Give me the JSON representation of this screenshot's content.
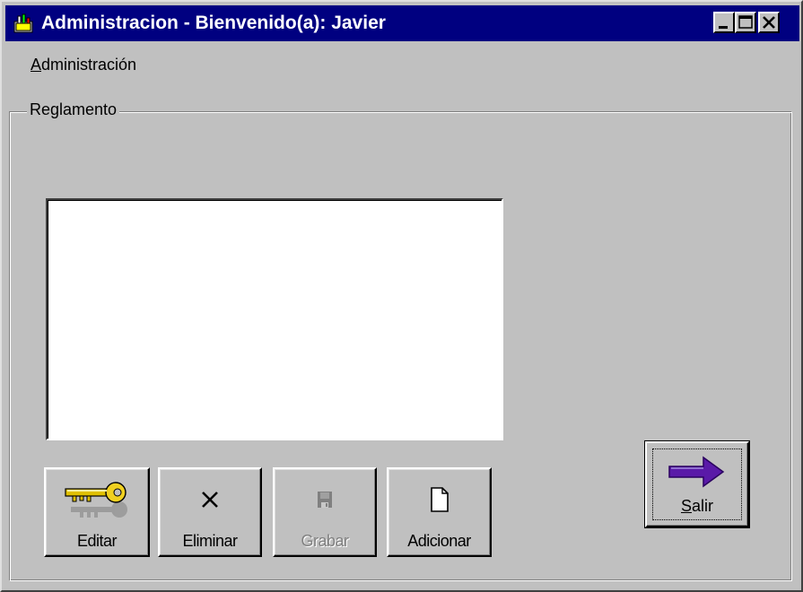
{
  "window": {
    "title": "Administracion - Bienvenido(a): Javier",
    "controls": {
      "minimize": "minimize-icon",
      "maximize": "maximize-icon",
      "close": "close-icon"
    }
  },
  "menu": {
    "items": [
      {
        "label_first": "A",
        "label_rest": "dministración"
      }
    ]
  },
  "group": {
    "label": "Reglamento"
  },
  "list": {
    "items": []
  },
  "toolbar": {
    "editar_label": "Editar",
    "eliminar_label": "Eliminar",
    "grabar_label": "Grabar",
    "adicionar_label": "Adicionar"
  },
  "exit": {
    "label_first": "S",
    "label_rest": "alir"
  },
  "colors": {
    "titlebar": "#000080",
    "face": "#c0c0c0",
    "arrow": "#5000a0"
  }
}
